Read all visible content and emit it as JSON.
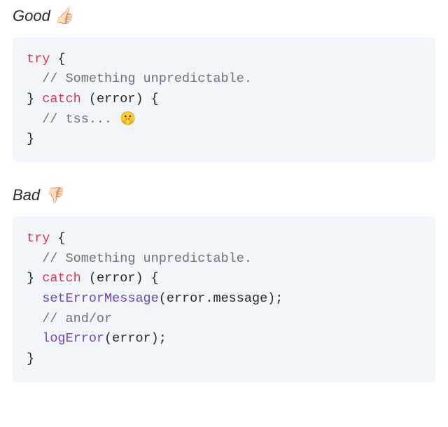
{
  "good": {
    "heading": "Good 👍🏻",
    "code": {
      "l1_try": "try",
      "l1_brace": " {",
      "l2_cmt": "  // Something unpredictable.",
      "l3_rb": "} ",
      "l3_catch": "catch",
      "l3_rest": " (error) {",
      "l4_cmt": "  // tss... 🤫",
      "l5": "}"
    }
  },
  "bad": {
    "heading": "Bad 👎🏻",
    "code": {
      "l1_try": "try",
      "l1_brace": " {",
      "l2_cmt": "  // Something unpredictable.",
      "l3_rb": "} ",
      "l3_catch": "catch",
      "l3_rest": " (error) {",
      "l4_indent": "  ",
      "l4_fn": "setErrorMessage",
      "l4_args": "(error.message);",
      "l5_cmt": "  // and/or",
      "l6_indent": "  ",
      "l6_fn": "logError",
      "l6_args": "(error);",
      "l7": "}"
    }
  }
}
